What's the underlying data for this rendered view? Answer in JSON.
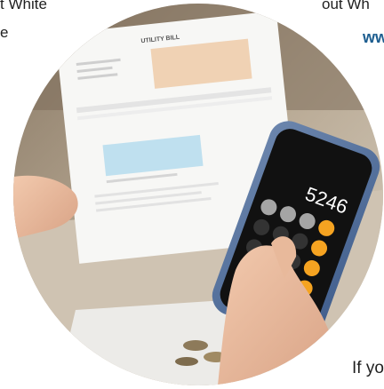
{
  "text_fragments": {
    "top_left_line1": "t White",
    "top_left_line2": "e",
    "top_right_line1": "out Wh",
    "top_right_line2": "ww",
    "bottom_right": "If yo"
  },
  "photo": {
    "bill_title": "UTILITY BILL",
    "calculator_display": "5246"
  },
  "colors": {
    "link_blue": "#1c5d8f",
    "bill_highlight_peach": "#f0d2b4",
    "bill_highlight_blue": "#bfe0ef",
    "calc_orange": "#f5a321",
    "phone_case_blue": "#4a6b9c"
  }
}
